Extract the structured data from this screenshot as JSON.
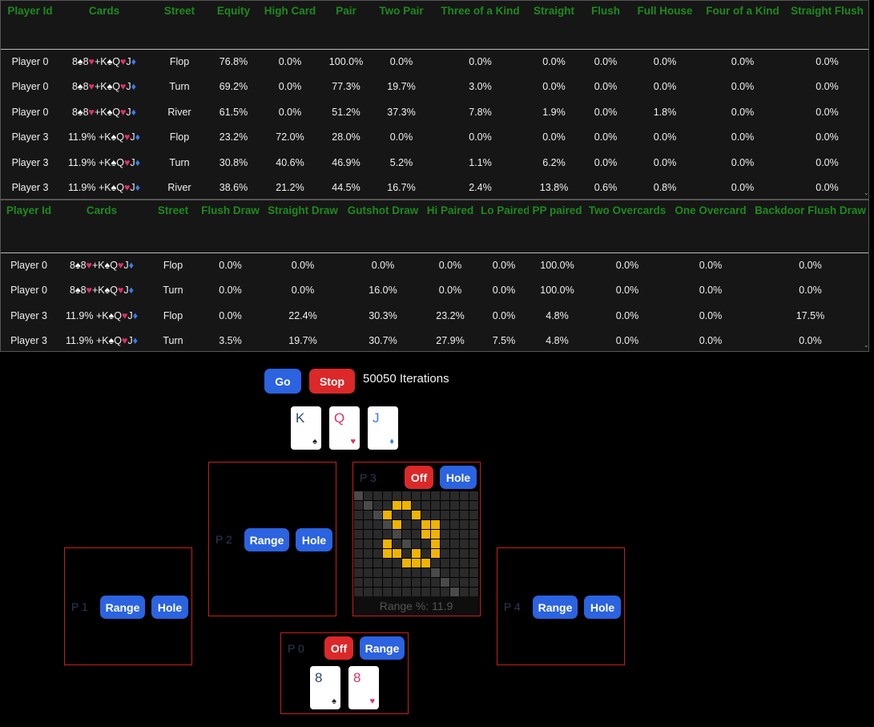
{
  "table1": {
    "headers": [
      "Player Id",
      "Cards",
      "Street",
      "Equity",
      "High Card",
      "Pair",
      "Two Pair",
      "Three of a Kind",
      "Straight",
      "Flush",
      "Full House",
      "Four of a Kind",
      "Straight Flush"
    ],
    "rows": [
      {
        "player": "Player 0",
        "cards": "8♠8♥+K♠Q♥J♦",
        "street": "Flop",
        "values": [
          "76.8%",
          "0.0%",
          "100.0%",
          "0.0%",
          "0.0%",
          "0.0%",
          "0.0%",
          "0.0%",
          "0.0%",
          "0.0%"
        ]
      },
      {
        "player": "Player 0",
        "cards": "8♠8♥+K♠Q♥J♦",
        "street": "Turn",
        "values": [
          "69.2%",
          "0.0%",
          "77.3%",
          "19.7%",
          "3.0%",
          "0.0%",
          "0.0%",
          "0.0%",
          "0.0%",
          "0.0%"
        ]
      },
      {
        "player": "Player 0",
        "cards": "8♠8♥+K♠Q♥J♦",
        "street": "River",
        "values": [
          "61.5%",
          "0.0%",
          "51.2%",
          "37.3%",
          "7.8%",
          "1.9%",
          "0.0%",
          "1.8%",
          "0.0%",
          "0.0%"
        ]
      },
      {
        "player": "Player 3",
        "cards": "11.9% +K♠Q♥J♦",
        "street": "Flop",
        "values": [
          "23.2%",
          "72.0%",
          "28.0%",
          "0.0%",
          "0.0%",
          "0.0%",
          "0.0%",
          "0.0%",
          "0.0%",
          "0.0%"
        ]
      },
      {
        "player": "Player 3",
        "cards": "11.9% +K♠Q♥J♦",
        "street": "Turn",
        "values": [
          "30.8%",
          "40.6%",
          "46.9%",
          "5.2%",
          "1.1%",
          "6.2%",
          "0.0%",
          "0.0%",
          "0.0%",
          "0.0%"
        ]
      },
      {
        "player": "Player 3",
        "cards": "11.9% +K♠Q♥J♦",
        "street": "River",
        "values": [
          "38.6%",
          "21.2%",
          "44.5%",
          "16.7%",
          "2.4%",
          "13.8%",
          "0.6%",
          "0.8%",
          "0.0%",
          "0.0%"
        ]
      }
    ]
  },
  "table2": {
    "headers": [
      "Player Id",
      "Cards",
      "Street",
      "Flush Draw",
      "Straight Draw",
      "Gutshot Draw",
      "Hi Paired",
      "Lo Paired",
      "PP paired",
      "Two Overcards",
      "One Overcard",
      "Backdoor Flush Draw"
    ],
    "rows": [
      {
        "player": "Player 0",
        "cards": "8♠8♥+K♠Q♥J♦",
        "street": "Flop",
        "values": [
          "0.0%",
          "0.0%",
          "0.0%",
          "0.0%",
          "0.0%",
          "100.0%",
          "0.0%",
          "0.0%",
          "0.0%"
        ]
      },
      {
        "player": "Player 0",
        "cards": "8♠8♥+K♠Q♥J♦",
        "street": "Turn",
        "values": [
          "0.0%",
          "0.0%",
          "16.0%",
          "0.0%",
          "0.0%",
          "100.0%",
          "0.0%",
          "0.0%",
          "0.0%"
        ]
      },
      {
        "player": "Player 3",
        "cards": "11.9% +K♠Q♥J♦",
        "street": "Flop",
        "values": [
          "0.0%",
          "22.4%",
          "30.3%",
          "23.2%",
          "0.0%",
          "4.8%",
          "0.0%",
          "0.0%",
          "17.5%"
        ]
      },
      {
        "player": "Player 3",
        "cards": "11.9% +K♠Q♥J♦",
        "street": "Turn",
        "values": [
          "3.5%",
          "19.7%",
          "30.7%",
          "27.9%",
          "7.5%",
          "4.8%",
          "0.0%",
          "0.0%",
          "0.0%"
        ]
      }
    ]
  },
  "controls": {
    "go_label": "Go",
    "stop_label": "Stop",
    "iterations_text": "50050 Iterations"
  },
  "board": [
    {
      "rank": "K",
      "suit": "♠",
      "rank_color": "dark"
    },
    {
      "rank": "Q",
      "suit": "♥",
      "rank_color": "pink"
    },
    {
      "rank": "J",
      "suit": "♦",
      "rank_color": "blue"
    }
  ],
  "seats": {
    "p0": {
      "label": "P 0",
      "off_label": "Off",
      "range_label": "Range",
      "cards": [
        {
          "rank": "8",
          "suit": "♠",
          "rank_color": "dark"
        },
        {
          "rank": "8",
          "suit": "♥",
          "rank_color": "pink"
        }
      ]
    },
    "p1": {
      "label": "P 1",
      "range_label": "Range",
      "hole_label": "Hole"
    },
    "p2": {
      "label": "P 2",
      "range_label": "Range",
      "hole_label": "Hole"
    },
    "p3": {
      "label": "P 3",
      "off_label": "Off",
      "hole_label": "Hole",
      "range_pct_text": "Range %: 11.9",
      "highlighted_cells": [
        [
          1,
          4
        ],
        [
          1,
          5
        ],
        [
          2,
          3
        ],
        [
          2,
          6
        ],
        [
          3,
          4
        ],
        [
          3,
          7
        ],
        [
          3,
          8
        ],
        [
          4,
          7
        ],
        [
          4,
          8
        ],
        [
          5,
          3
        ],
        [
          5,
          8
        ],
        [
          6,
          3
        ],
        [
          6,
          4
        ],
        [
          6,
          6
        ],
        [
          6,
          8
        ],
        [
          7,
          5
        ],
        [
          7,
          6
        ],
        [
          7,
          7
        ]
      ]
    },
    "p4": {
      "label": "P 4",
      "range_label": "Range",
      "hole_label": "Hole"
    }
  },
  "colors": {
    "accent_blue": "#2b63e0",
    "accent_red": "#dc2828",
    "header_green": "#1d8a1d",
    "highlight": "#f0b400",
    "seat_border": "#c81e1e"
  }
}
